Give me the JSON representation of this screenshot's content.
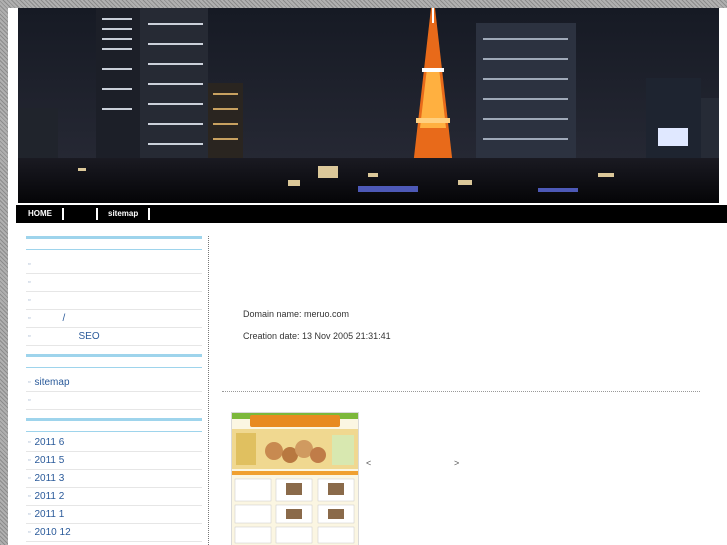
{
  "nav": {
    "items": [
      {
        "label": "HOME"
      },
      {
        "label": ""
      },
      {
        "label": "sitemap"
      }
    ]
  },
  "sidebar": {
    "group1": [
      "",
      "",
      "",
      "/",
      "SEO"
    ],
    "group2": [
      "sitemap",
      ""
    ],
    "archives": [
      "2011 6",
      "2011 5",
      "2011 3",
      "2011 2",
      "2011 1",
      "2010 12"
    ]
  },
  "main": {
    "domain_line": "Domain name: meruo.com",
    "creation_line": "Creation date: 13 Nov 2005 21:31:41",
    "prev_label": "<",
    "next_label": ">"
  },
  "colors": {
    "accent_line": "#9ed4ec",
    "link": "#2a5a9a",
    "nav_bg": "#000000"
  }
}
